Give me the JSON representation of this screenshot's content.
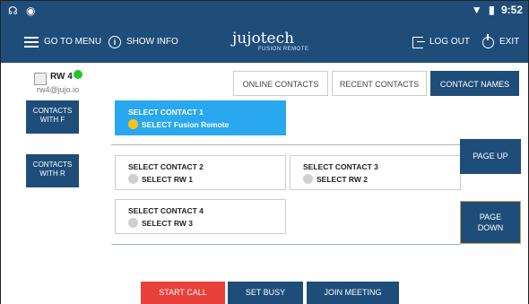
{
  "status_bar": {
    "left_icons": [
      "mic-icon",
      "android-icon"
    ],
    "right_icons": [
      "wifi-icon",
      "battery-icon"
    ],
    "time": "9:52"
  },
  "header": {
    "menu_label": "GO TO MENU",
    "info_label": "SHOW INFO",
    "brand": "jujotech",
    "brand_sub": "FUSION REMOTE",
    "logout_label": "LOG OUT",
    "exit_label": "EXIT",
    "bg_color": "#1f4d7a"
  },
  "user": {
    "name": "RW 4",
    "email": "rw4@jujo.io",
    "status_color": "#22c52a"
  },
  "tabs": [
    {
      "label": "ONLINE CONTACTS",
      "active": false
    },
    {
      "label": "RECENT CONTACTS",
      "active": false
    },
    {
      "label": "CONTACT NAMES",
      "active": true
    }
  ],
  "filters": [
    {
      "line1": "CONTACTS",
      "line2": "WITH F"
    },
    {
      "line1": "CONTACTS",
      "line2": "WITH R"
    }
  ],
  "contacts": [
    {
      "title": "SELECT CONTACT 1",
      "sub": "SELECT Fusion Remote",
      "selected": true
    },
    {
      "title": "SELECT CONTACT 2",
      "sub": "SELECT RW 1",
      "selected": false
    },
    {
      "title": "SELECT CONTACT 3",
      "sub": "SELECT RW 2",
      "selected": false
    },
    {
      "title": "SELECT CONTACT 4",
      "sub": "SELECT RW 3",
      "selected": false
    }
  ],
  "paging": {
    "up_label": "PAGE UP",
    "down_line1": "PAGE",
    "down_line2": "DOWN"
  },
  "actions": {
    "start_call": "START CALL",
    "set_busy": "SET BUSY",
    "join_meeting": "JOIN MEETING",
    "start_color": "#e8403a",
    "other_color": "#1f4d7a"
  }
}
